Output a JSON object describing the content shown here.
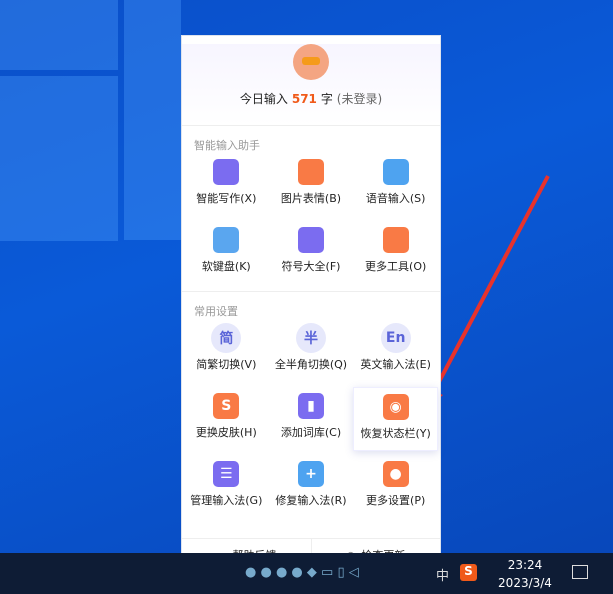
{
  "header": {
    "today_prefix": "今日输入",
    "count": "571",
    "unit": "字",
    "login_status": "(未登录)"
  },
  "section1": {
    "title": "智能输入助手",
    "items": [
      {
        "label": "智能写作(X)",
        "icon": "pen-icon",
        "color": "#7b6cf0"
      },
      {
        "label": "图片表情(B)",
        "icon": "smiley-icon",
        "color": "#f97a45"
      },
      {
        "label": "语音输入(S)",
        "icon": "microphone-icon",
        "color": "#4ea3f0"
      },
      {
        "label": "软键盘(K)",
        "icon": "keyboard-icon",
        "color": "#5aa6ef"
      },
      {
        "label": "符号大全(F)",
        "icon": "omega-icon",
        "color": "#7b6cf0"
      },
      {
        "label": "更多工具(O)",
        "icon": "apps-icon",
        "color": "#f97a45"
      }
    ]
  },
  "section2": {
    "title": "常用设置",
    "items": [
      {
        "label": "简繁切换(V)",
        "glyph": "简"
      },
      {
        "label": "全半角切换(Q)",
        "glyph": "半"
      },
      {
        "label": "英文输入法(E)",
        "glyph": "En"
      },
      {
        "label": "更换皮肤(H)",
        "icon": "tshirt-icon",
        "glyph": "S",
        "color": "#f97a45"
      },
      {
        "label": "添加词库(C)",
        "icon": "book-icon",
        "glyph": "▮",
        "color": "#7b6cf0"
      },
      {
        "label": "恢复状态栏(Y)",
        "icon": "eye-icon",
        "glyph": "◉",
        "color": "#f97a45"
      },
      {
        "label": "管理输入法(G)",
        "icon": "sliders-icon",
        "glyph": "☰",
        "color": "#7b6cf0"
      },
      {
        "label": "修复输入法(R)",
        "icon": "toolbox-icon",
        "glyph": "+",
        "color": "#4ea3f0"
      },
      {
        "label": "更多设置(P)",
        "icon": "hexagon-gear-icon",
        "glyph": "●",
        "color": "#f97a45"
      }
    ]
  },
  "footer": {
    "help": "帮助反馈",
    "update": "检查更新"
  },
  "taskbar": {
    "ime": "中",
    "time": "23:24",
    "date": "2023/3/4"
  }
}
